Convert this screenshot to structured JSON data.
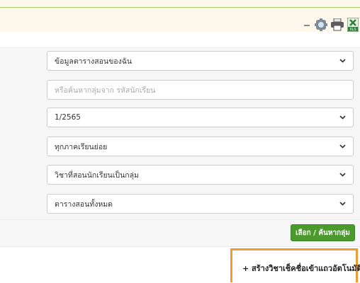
{
  "toolbar": {
    "icons": [
      "minus-icon",
      "settings-cog-icon",
      "printer-icon",
      "excel-export-icon"
    ],
    "excel_badge": "XLS",
    "colors": {
      "excel": "#2f7d3a",
      "icon_gray": "#6c6c6c"
    }
  },
  "filters": {
    "view_select": "ข้อมูลตารางสอนของฉัน",
    "search_placeholder": "หรือค้นหากลุ่มจาก รหัสนักเรียน",
    "term_select": "1/2565",
    "level_select": "ทุกภาคเรียนย่อย",
    "subject_select": "วิชาที่สอนนักเรียนเป็นกลุ่ม",
    "schedule_select": "ตารางสอนทั้งหมด",
    "submit_label": "เลือก / ค้นหากลุ่ม"
  },
  "actions": {
    "auto_create_label": "+ สร้างวิชาเช็คชื่อเข้าแถวอัตโนมัติ"
  },
  "colors": {
    "accent_green": "#4a9a2c",
    "highlight_orange": "#f39a33",
    "top_line": "#a8cf6a"
  }
}
